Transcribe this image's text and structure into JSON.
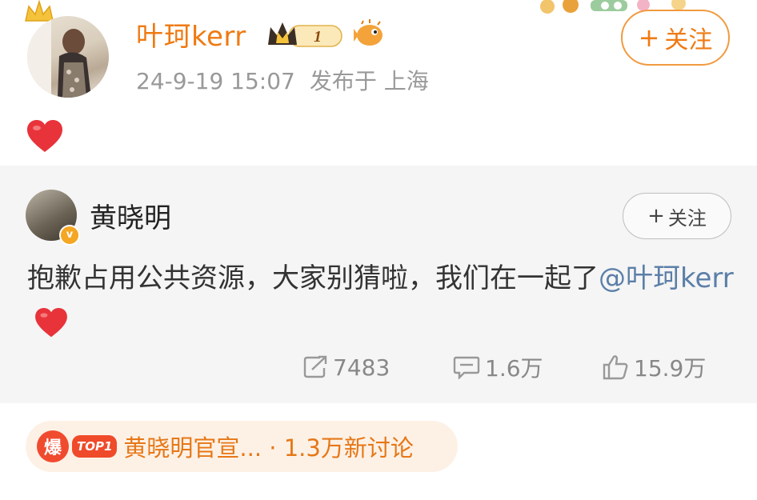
{
  "post": {
    "username": "叶珂kerr",
    "vip_level": "1",
    "timestamp": "24-9-19 15:07",
    "location": "发布于 上海",
    "follow_label": "关注",
    "body_icon": "heart-emoji"
  },
  "repost": {
    "username": "黄晓明",
    "follow_label": "关注",
    "text": "抱歉占用公共资源，大家别猜啦，我们在一起了",
    "mention": "@叶珂kerr",
    "stats": {
      "reposts": "7483",
      "comments": "1.6万",
      "likes": "15.9万"
    }
  },
  "hot_topic": {
    "hot_icon_text": "爆",
    "rank_label": "TOP1",
    "text": "黄晓明官宣... · 1.3万新讨论"
  },
  "colors": {
    "accent_orange": "#ef7a12",
    "mention_blue": "#5b7fa8",
    "heart_red": "#e8333a",
    "repost_bg": "#f5f5f5"
  }
}
